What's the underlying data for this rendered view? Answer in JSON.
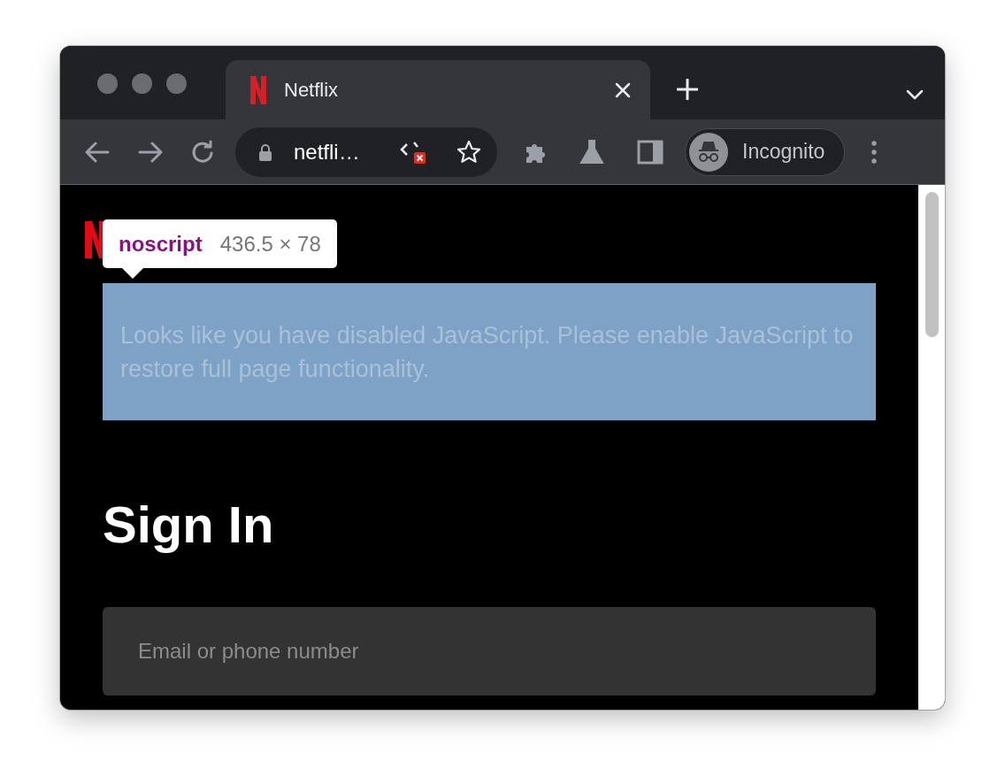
{
  "browser": {
    "tab": {
      "title": "Netflix",
      "selected": true
    },
    "address": "netfli…",
    "profile": "Incognito"
  },
  "page": {
    "inspector_tooltip": {
      "tag": "noscript",
      "size": "436.5 × 78"
    },
    "notice": "Looks like you have disabled JavaScript. Please enable JavaScript to restore full page functionality.",
    "heading": "Sign In",
    "email": {
      "placeholder": "Email or phone number"
    }
  }
}
